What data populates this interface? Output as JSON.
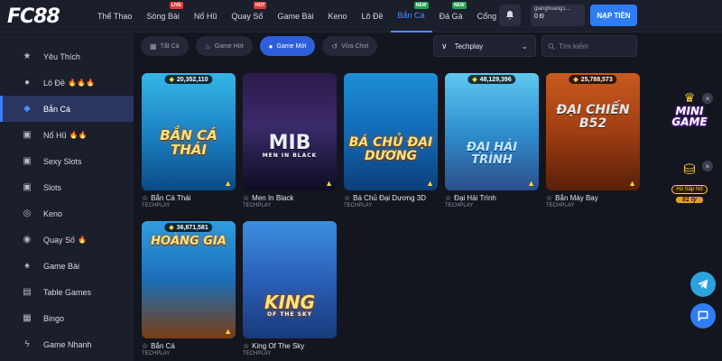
{
  "header": {
    "logo_text": "FC",
    "logo_num": "88",
    "nav": [
      {
        "label": "Thể Thao",
        "badge": ""
      },
      {
        "label": "Sòng Bài",
        "badge": "LIVE"
      },
      {
        "label": "Nổ Hũ",
        "badge": ""
      },
      {
        "label": "Quay Số",
        "badge": "HOT"
      },
      {
        "label": "Game Bài",
        "badge": ""
      },
      {
        "label": "Keno",
        "badge": ""
      },
      {
        "label": "Lô Đề",
        "badge": ""
      },
      {
        "label": "Bắn Cá",
        "badge": "NEW"
      },
      {
        "label": "Đá Gà",
        "badge": "NEW"
      },
      {
        "label": "Cổng Game",
        "badge": ""
      }
    ],
    "username": "gianghoang1...",
    "balance": "0 Đ",
    "deposit_label": "NẠP TIỀN"
  },
  "sidebar": {
    "items": [
      {
        "label": "Yêu Thích",
        "icon": "star-icon",
        "fires": ""
      },
      {
        "label": "Lô Đề",
        "icon": "ball-icon",
        "fires": "🔥🔥🔥"
      },
      {
        "label": "Bắn Cá",
        "icon": "fish-icon",
        "fires": ""
      },
      {
        "label": "Nổ Hũ",
        "icon": "slot-icon",
        "fires": "🔥🔥"
      },
      {
        "label": "Sexy Slots",
        "icon": "slot-icon",
        "fires": ""
      },
      {
        "label": "Slots",
        "icon": "slot-icon",
        "fires": ""
      },
      {
        "label": "Keno",
        "icon": "keno-icon",
        "fires": ""
      },
      {
        "label": "Quay Số",
        "icon": "dice-icon",
        "fires": "🔥"
      },
      {
        "label": "Game Bài",
        "icon": "cards-icon",
        "fires": ""
      },
      {
        "label": "Table Games",
        "icon": "table-icon",
        "fires": ""
      },
      {
        "label": "Bingo",
        "icon": "bingo-icon",
        "fires": ""
      },
      {
        "label": "Game Nhanh",
        "icon": "bolt-icon",
        "fires": ""
      }
    ]
  },
  "filters": {
    "chips": [
      "Tất Cả",
      "Game Hot",
      "Game Mới",
      "Vừa Chơi"
    ],
    "active": "Game Mới",
    "provider": "Techplay",
    "search_placeholder": "Tìm kiếm"
  },
  "games": [
    {
      "name": "Bắn Cá Thái",
      "provider": "TECHPLAY",
      "jackpot": "20,352,110",
      "art_title": "BẮN CÁ THÁI",
      "art_sub": ""
    },
    {
      "name": "Men In Black",
      "provider": "TECHPLAY",
      "jackpot": "",
      "art_title": "MIB",
      "art_sub": "MEN IN BLACK"
    },
    {
      "name": "Bá Chủ Đại Dương 3D",
      "provider": "TECHPLAY",
      "jackpot": "",
      "art_title": "BÁ CHỦ ĐẠI DƯƠNG",
      "art_sub": ""
    },
    {
      "name": "Đại Hải Trình",
      "provider": "TECHPLAY",
      "jackpot": "48,129,396",
      "art_title": "ĐẠI HẢI TRÌNH",
      "art_sub": ""
    },
    {
      "name": "Bắn Máy Bay",
      "provider": "TECHPLAY",
      "jackpot": "25,788,573",
      "art_title": "ĐẠI CHIẾN B52",
      "art_sub": ""
    },
    {
      "name": "Bắn Cá",
      "provider": "TECHPLAY",
      "jackpot": "36,871,581",
      "art_title": "HOÀNG GIA",
      "art_sub": ""
    },
    {
      "name": "King Of The Sky",
      "provider": "TECHPLAY",
      "jackpot": "",
      "art_title": "KING",
      "art_sub": "OF THE SKY"
    }
  ],
  "floating": {
    "mini_title": "MINI GAME",
    "pot_label": "Hũ Sắp Nổ",
    "pot_amount": "81 tỷ"
  },
  "colors": {
    "accent": "#2e7cf6",
    "background": "#14161f",
    "panel": "#1b1e2b",
    "jackpot": "#ffd23a"
  }
}
